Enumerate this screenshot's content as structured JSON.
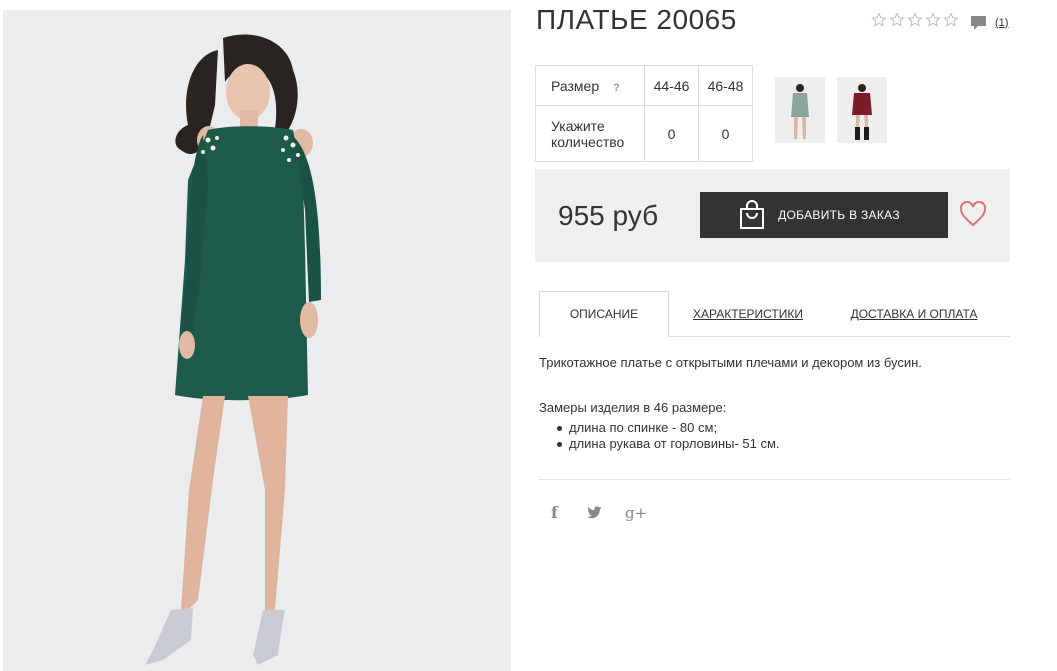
{
  "product": {
    "title": "ПЛАТЬЕ 20065",
    "rating": {
      "value": 0,
      "max": 5
    },
    "comments_count": "(1)"
  },
  "sizes": {
    "size_label": "Размер",
    "help_mark": "?",
    "qty_label": "Укажите количество",
    "columns": [
      {
        "size": "44-46",
        "qty": "0"
      },
      {
        "size": "46-48",
        "qty": "0"
      }
    ]
  },
  "color_variants": [
    "green",
    "burgundy"
  ],
  "purchase": {
    "price": "955 руб",
    "add_button": "ДОБАВИТЬ В ЗАКАЗ"
  },
  "tabs": [
    {
      "label": "ОПИСАНИЕ",
      "active": true
    },
    {
      "label": "ХАРАКТЕРИСТИКИ",
      "active": false
    },
    {
      "label": "ДОСТАВКА И ОПЛАТА",
      "active": false
    }
  ],
  "description": {
    "text": "Трикотажное платье с открытыми плечами и декором из бусин.",
    "measures_title": "Замеры изделия в 46 размере:",
    "measures": [
      "длина по спинке - 80 см;",
      "длина рукава от горловины- 51 см."
    ]
  },
  "social": {
    "facebook": "f",
    "googleplus": "g+"
  },
  "icons": [
    "star-icon",
    "comment-icon",
    "question-icon",
    "shopping-bag-icon",
    "heart-icon",
    "facebook-icon",
    "twitter-icon",
    "google-plus-icon"
  ],
  "colors": {
    "dress_green": "#1d5a4a",
    "dress_burgundy": "#7a1c2a",
    "button_bg": "#333333",
    "price_box_bg": "#efefef",
    "heart": "#e0707a"
  }
}
